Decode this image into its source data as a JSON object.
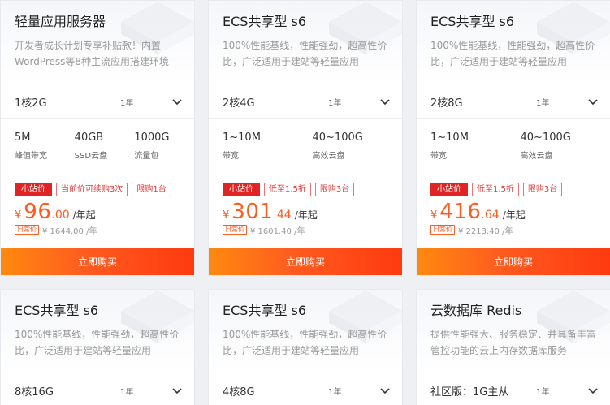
{
  "cards": [
    {
      "title": "轻量应用服务器",
      "desc": "开发者成长计划专享补贴款！内置WordPress等8种主流应用搭建环境",
      "spec": "1核2G",
      "duration": "1年",
      "metrics": [
        {
          "value": "5M",
          "label": "峰值带宽"
        },
        {
          "value": "40GB",
          "label": "SSD云盘"
        },
        {
          "value": "1000G",
          "label": "流量包"
        }
      ],
      "tags": [
        "小站价",
        "当前价可续购3次",
        "限购1台"
      ],
      "price": {
        "currency": "¥",
        "int": "96",
        "dec": ".00",
        "unit": "/年起"
      },
      "orig": {
        "badge": "日常价",
        "value": "¥ 1644.00 /年"
      },
      "buy": "立即购买"
    },
    {
      "title": "ECS共享型 s6",
      "desc": "100%性能基线，性能强劲，超高性价比，广泛适用于建站等轻量应用",
      "spec": "2核4G",
      "duration": "1年",
      "metrics": [
        {
          "value": "1~10M",
          "label": "带宽"
        },
        {
          "value": "40~100G",
          "label": "高效云盘"
        }
      ],
      "tags": [
        "小站价",
        "低至1.5折",
        "限购3台"
      ],
      "price": {
        "currency": "¥",
        "int": "301",
        "dec": ".44",
        "unit": "/年起"
      },
      "orig": {
        "badge": "日常价",
        "value": "¥ 1601.40 /年"
      },
      "buy": "立即购买"
    },
    {
      "title": "ECS共享型 s6",
      "desc": "100%性能基线，性能强劲，超高性价比，广泛适用于建站等轻量应用",
      "spec": "2核8G",
      "duration": "1年",
      "metrics": [
        {
          "value": "1~10M",
          "label": "带宽"
        },
        {
          "value": "40~100G",
          "label": "高效云盘"
        }
      ],
      "tags": [
        "小站价",
        "低至1.5折",
        "限购3台"
      ],
      "price": {
        "currency": "¥",
        "int": "416",
        "dec": ".64",
        "unit": "/年起"
      },
      "orig": {
        "badge": "日常价",
        "value": "¥ 2213.40 /年"
      },
      "buy": "立即购买"
    },
    {
      "title": "ECS共享型 s6",
      "desc": "100%性能基线，性能强劲，超高性价比，广泛适用于建站等轻量应用",
      "spec": "8核16G",
      "duration": "1年"
    },
    {
      "title": "ECS共享型 s6",
      "desc": "100%性能基线，性能强劲，超高性价比，广泛适用于建站等轻量应用",
      "spec": "4核8G",
      "duration": "1年"
    },
    {
      "title": "云数据库 Redis",
      "desc": "提供性能强大、服务稳定、并具备丰富管控功能的云上内存数据库服务",
      "spec": "社区版：1G主从",
      "duration": "1年"
    }
  ],
  "colors": {
    "accent": "#ff5a1f",
    "tag_red": "#e02424",
    "buy_start": "#ff8a0f",
    "buy_end": "#ff3a0f"
  },
  "icons": {
    "dropdown": "chevron-down-icon"
  }
}
